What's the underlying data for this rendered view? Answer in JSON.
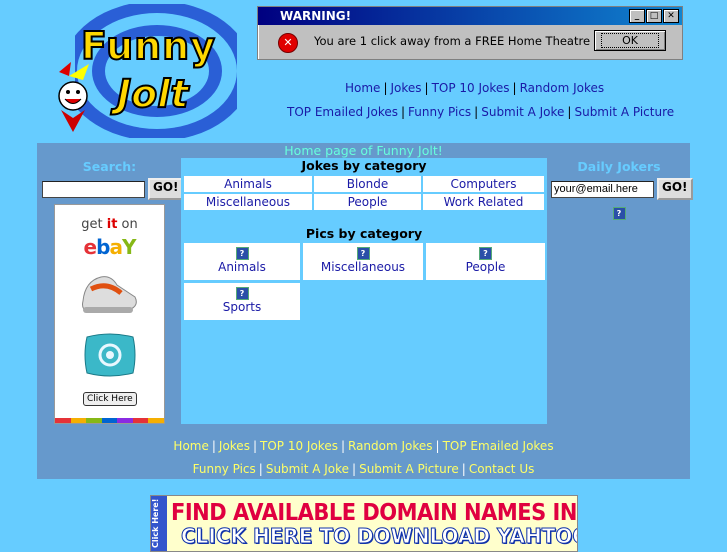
{
  "logo": {
    "line1": "Funny",
    "line2": "Jolt"
  },
  "popup": {
    "title": "WARNING!",
    "message": "You are 1 click away from a FREE Home Theatre",
    "ok_label": "OK",
    "min_glyph": "_",
    "max_glyph": "□",
    "close_glyph": "✕"
  },
  "topnav": {
    "row1": [
      "Home",
      "Jokes",
      "TOP 10 Jokes",
      "Random Jokes"
    ],
    "row2": [
      "TOP Emailed Jokes",
      "Funny Pics",
      "Submit A Joke",
      "Submit A Picture"
    ]
  },
  "main": {
    "title": "Home page of Funny Jolt!",
    "search_title": "Search:",
    "search_value": "",
    "go_label": "GO!",
    "ebay": {
      "get": "get ",
      "it": "it",
      "on": " on",
      "click_label": "Click Here"
    },
    "jokes_title": "Jokes by category",
    "joke_categories": [
      "Animals",
      "Blonde",
      "Computers",
      "Miscellaneous",
      "People",
      "Work Related"
    ],
    "pics_title": "Pics by category",
    "pic_categories": [
      "Animals",
      "Miscellaneous",
      "People",
      "Sports"
    ],
    "daily_title": "Daily Jokers",
    "email_value": "your@email.here",
    "question_glyph": "?"
  },
  "bottomnav": {
    "row1": [
      "Home",
      "Jokes",
      "TOP 10 Jokes",
      "Random Jokes",
      "TOP Emailed Jokes"
    ],
    "row2": [
      "Funny Pics",
      "Submit A Joke",
      "Submit A Picture",
      "Contact Us"
    ]
  },
  "banner": {
    "side": "Click Here!",
    "line1": "FIND AVAILABLE DOMAIN NAMES IN YAHOO!",
    "line2": "CLICK HERE TO DOWNLOAD YAHTOOL FOR FREE!"
  },
  "colors": {
    "background": "#66ccff",
    "panel": "#6699cc",
    "nav_yellow": "#ffff66",
    "link": "#1a1aa6"
  }
}
